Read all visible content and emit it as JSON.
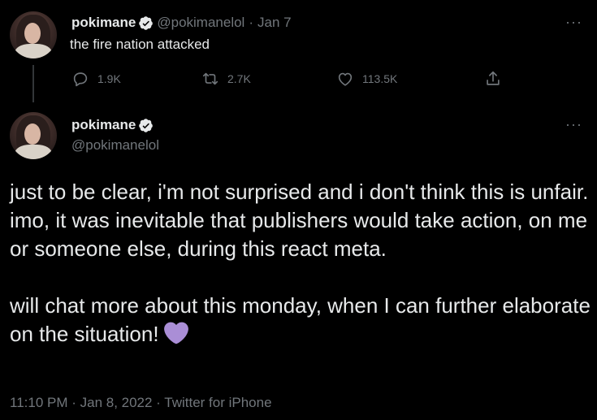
{
  "reply_tweet": {
    "display_name": "pokimane",
    "handle": "@pokimanelol",
    "separator": "·",
    "date": "Jan 7",
    "text": "the fire nation attacked",
    "more_label": "···",
    "actions": {
      "reply_count": "1.9K",
      "retweet_count": "2.7K",
      "like_count": "113.5K"
    }
  },
  "main_tweet": {
    "display_name": "pokimane",
    "handle": "@pokimanelol",
    "more_label": "···",
    "paragraph1": "just to be clear, i'm not surprised and i don't think this is unfair. imo, it was inevitable that publishers would take action, on me or someone else, during this react meta.",
    "paragraph2": "will chat more about this monday, when I can further elaborate on the situation!",
    "emoji": "purple-heart",
    "meta": "11:10 PM · Jan 8, 2022 · Twitter for iPhone"
  },
  "icons": {
    "verified": "verified-badge-icon",
    "reply": "reply-icon",
    "retweet": "retweet-icon",
    "like": "heart-icon",
    "share": "share-icon",
    "more": "more-icon"
  },
  "colors": {
    "background": "#000000",
    "text": "#e7e9ea",
    "secondary": "#71767b",
    "heart_emoji": "#aa8ed6"
  }
}
